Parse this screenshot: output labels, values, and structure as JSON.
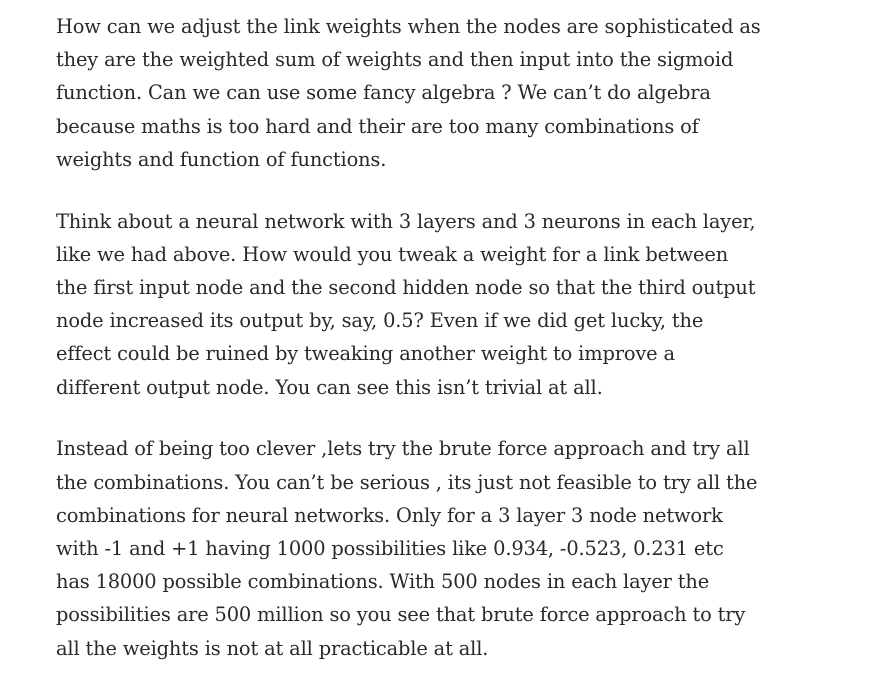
{
  "article": {
    "paragraphs": [
      "How can we adjust the link weights when the nodes are sophisticated as they are the weighted sum of weights and then input into the sigmoid function. Can we can use some fancy algebra ? We can’t do algebra because maths is too hard and their are too many combinations of weights and function of functions.",
      "Think about a neural network with 3 layers and 3 neurons in each layer, like we had above. How would you tweak a weight for a link between the first input node and the second hidden node so that the third output node increased its output by, say, 0.5? Even if we did get lucky, the effect could be ruined by tweaking another weight to improve a different output node. You can see this isn’t trivial at all.",
      "Instead of being too clever ,lets try the brute force approach and try all the combinations. You can’t be serious , its just not feasible to try all the combinations for neural networks. Only for a 3 layer 3 node network with -1 and +1 having 1000 possibilities like 0.934, -0.523, 0.231 etc has 18000 possible combinations. With 500 nodes in each layer the possibilities are 500 million so you see that brute force approach to try all the weights is not at all practicable at all."
    ]
  }
}
